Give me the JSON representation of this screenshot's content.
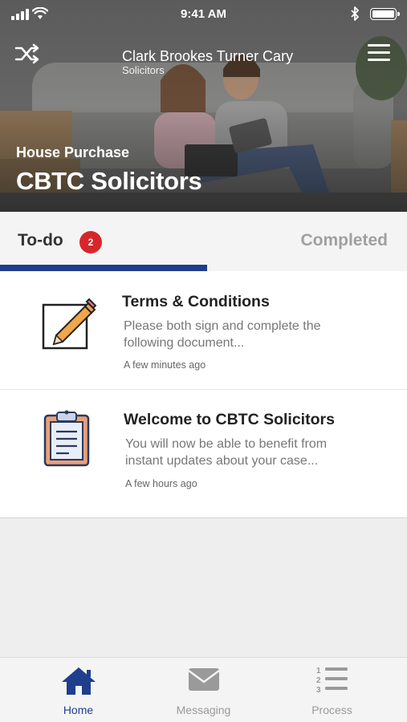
{
  "status_bar": {
    "time": "9:41 AM"
  },
  "header": {
    "firm_name": "Clark Brookes Turner Cary",
    "firm_subtitle": "Solicitors",
    "matter_type": "House Purchase",
    "matter_title": "CBTC Solicitors",
    "icons": {
      "left": "shuffle-icon",
      "right": "hamburger-menu-icon"
    }
  },
  "tabs": {
    "todo_label": "To-do",
    "todo_count": "2",
    "completed_label": "Completed",
    "active": "To-do"
  },
  "tasks": [
    {
      "title": "Terms & Conditions",
      "description": "Please both sign and complete the following document...",
      "time": "A few minutes ago",
      "icon": "edit-document-icon"
    },
    {
      "title": "Welcome to CBTC Solicitors",
      "description": "You will now be able to benefit from instant updates about your case...",
      "time": "A few hours ago",
      "icon": "clipboard-icon"
    }
  ],
  "bottom_nav": {
    "items": [
      {
        "label": "Home",
        "icon": "home-icon",
        "active": true
      },
      {
        "label": "Messaging",
        "icon": "envelope-icon",
        "active": false
      },
      {
        "label": "Process",
        "icon": "numbered-list-icon",
        "active": false
      }
    ]
  },
  "colors": {
    "brand_blue": "#1f3e8c",
    "badge_red": "#d7262a",
    "inactive_gray": "#a0a0a0"
  }
}
